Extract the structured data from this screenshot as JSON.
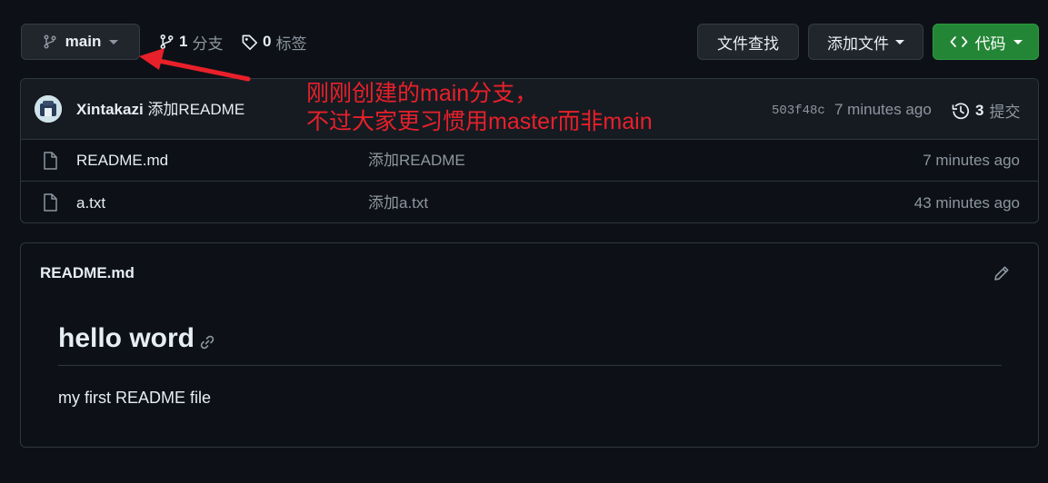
{
  "branch": {
    "name": "main"
  },
  "stats": {
    "branches_count": "1",
    "branches_label": "分支",
    "tags_count": "0",
    "tags_label": "标签"
  },
  "actions": {
    "find_file": "文件查找",
    "add_file": "添加文件",
    "code": "代码"
  },
  "commit": {
    "author": "Xintakazi",
    "message": "添加README",
    "sha": "503f48c",
    "time": "7 minutes ago",
    "count": "3",
    "count_label": "提交"
  },
  "files": [
    {
      "name": "README.md",
      "message": "添加README",
      "time": "7 minutes ago"
    },
    {
      "name": "a.txt",
      "message": "添加a.txt",
      "time": "43 minutes ago"
    }
  ],
  "readme": {
    "title": "README.md",
    "heading": "hello word",
    "body": "my first README file"
  },
  "annotation": {
    "line1": "刚刚创建的main分支，",
    "line2": "不过大家更习惯用master而非main",
    "color": "#e8202a"
  },
  "colors": {
    "background": "#0d1117",
    "border": "#30363d",
    "button": "#21262d",
    "code_button": "#238636",
    "muted": "#8d96a0"
  }
}
